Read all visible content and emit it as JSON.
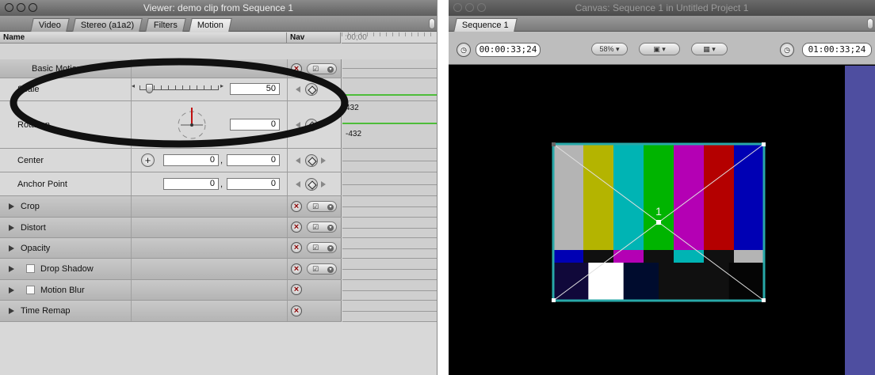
{
  "viewer": {
    "title": "Viewer: demo clip from Sequence 1",
    "tabs": [
      "Video",
      "Stereo (a1a2)",
      "Filters",
      "Motion"
    ],
    "active_tab": "Motion",
    "columns": {
      "name": "Name",
      "nav": "Nav",
      "time": ":00;00"
    },
    "rows": {
      "basic_motion": "Basic Motion",
      "scale": {
        "label": "Scale",
        "value": "50"
      },
      "rotation": {
        "label": "Rotation",
        "value": "0",
        "kf_top": "432",
        "kf_bottom": "-432"
      },
      "center": {
        "label": "Center",
        "x": "0",
        "y": "0"
      },
      "anchor": {
        "label": "Anchor Point",
        "x": "0",
        "y": "0"
      },
      "crop": "Crop",
      "distort": "Distort",
      "opacity": "Opacity",
      "drop_shadow": "Drop Shadow",
      "motion_blur": "Motion Blur",
      "time_remap": "Time Remap"
    },
    "glyphs": {
      "reset": "×",
      "menu": "☑",
      "dropdown": "▾",
      "center_target": "+",
      "separator": ",",
      "slider_left": "◂",
      "slider_right": "▸"
    }
  },
  "canvas": {
    "title": "Canvas: Sequence 1 in Untitled Project 1",
    "tab": "Sequence 1",
    "timecode_current": "00:00:33;24",
    "timecode_total": "01:00:33;24",
    "zoom": "58%",
    "clip_number": "1"
  },
  "colors": {
    "bars_top": [
      "#b4b4b4",
      "#b4b400",
      "#00b4b4",
      "#00b400",
      "#b400b4",
      "#b40000",
      "#0000b4"
    ],
    "bars_mid": [
      "#0000b4",
      "#101010",
      "#b400b4",
      "#101010",
      "#00b4b4",
      "#101010",
      "#b4b4b4"
    ],
    "bars_bottom": [
      "#10083a",
      "#ffffff",
      "#000c2e",
      "#101010",
      "#101010",
      "#050505"
    ],
    "annotation": "#111111",
    "selection": "#28a8a8"
  }
}
